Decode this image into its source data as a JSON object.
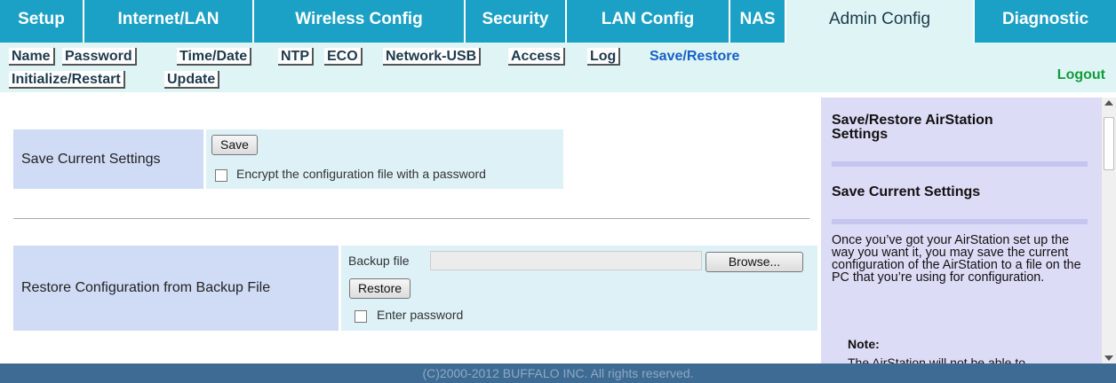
{
  "topnav": {
    "tabs": [
      "Setup",
      "Internet/LAN",
      "Wireless Config",
      "Security",
      "LAN Config",
      "NAS",
      "Admin Config",
      "Diagnostic"
    ]
  },
  "subnav": {
    "items": [
      "Name",
      "Password",
      "Time/Date",
      "NTP",
      "ECO",
      "Network-USB",
      "Access",
      "Log",
      "Save/Restore",
      "Initialize/Restart",
      "Update"
    ],
    "logout": "Logout"
  },
  "save": {
    "label": "Save Current Settings",
    "button": "Save",
    "encrypt_label": "Encrypt the configuration file with a password",
    "encrypt_checked": false
  },
  "restore": {
    "label": "Restore Configuration from Backup File",
    "file_label": "Backup file",
    "file_value": "",
    "browse": "Browse...",
    "button": "Restore",
    "password_label": "Enter password",
    "password_checked": false
  },
  "help": {
    "title": "Save/Restore AirStation Settings",
    "section": "Save Current Settings",
    "body": "Once you’ve got your AirStation set up the way you want it, you may save the current configuration of the AirStation to a file on the PC that you’re using for configuration.",
    "note": "Note:",
    "note_cut": "The AirStation will not be able to"
  },
  "footer": "(C)2000-2012 BUFFALO INC. All rights reserved."
}
